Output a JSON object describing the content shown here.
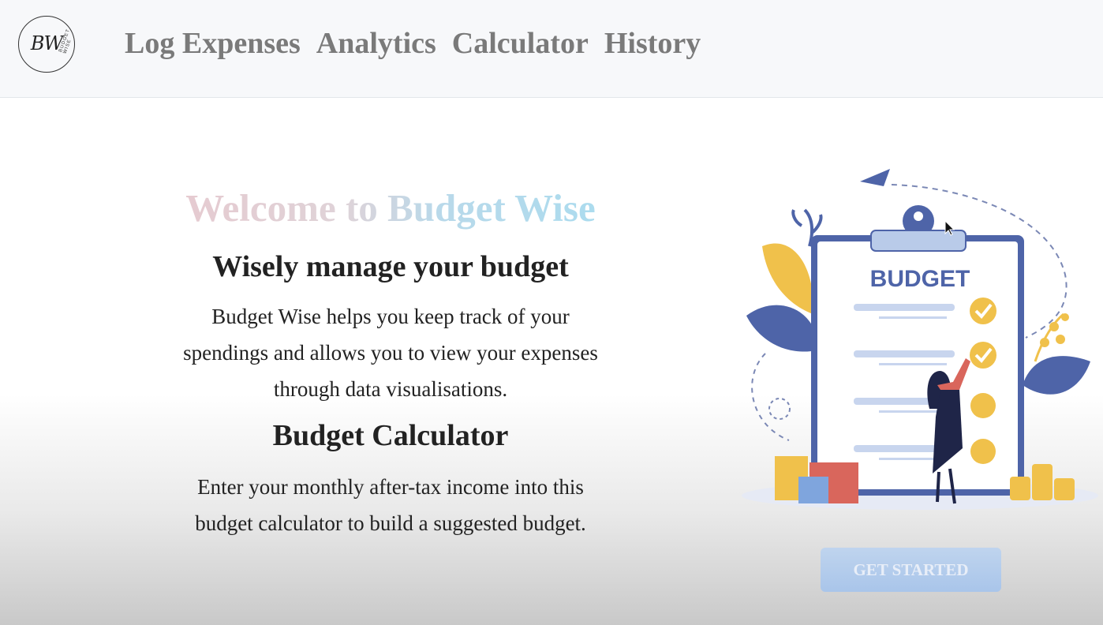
{
  "logo": {
    "text": "BW",
    "subtext": "BUDGET WISE"
  },
  "nav": {
    "items": [
      "Log Expenses",
      "Analytics",
      "Calculator",
      "History"
    ]
  },
  "hero": {
    "title": "Welcome to Budget Wise",
    "subtitle": "Wisely manage your budget",
    "description": "Budget Wise helps you keep track of your spendings and allows you to view your expenses through data visualisations.",
    "calc_title": "Budget Calculator",
    "calc_description": "Enter your monthly after-tax income into this budget calculator to build a suggested budget."
  },
  "illustration": {
    "label": "BUDGET"
  },
  "cta": {
    "label": "GET STARTED"
  },
  "colors": {
    "nav_text": "#7a7a7a",
    "heading": "#222222",
    "welcome_gradient": [
      "#e7c9cf",
      "#a9dcef"
    ],
    "button": "#b5cdec",
    "clipboard": "#5067a8",
    "accent_yellow": "#f0c14b"
  }
}
